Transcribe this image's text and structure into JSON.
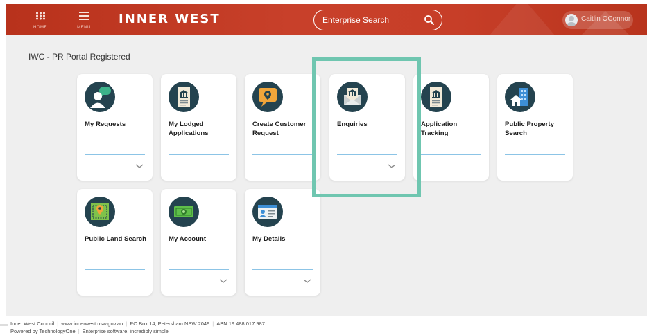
{
  "header": {
    "nav_home_label": "HOME",
    "nav_menu_label": "MENU",
    "brand": "INNER WEST",
    "search_placeholder": "Enterprise Search",
    "user_name": "Caitlin OConnor",
    "colors": {
      "header_red": "#c33b24",
      "accent_teal": "#6fc6b0",
      "icon_navy": "#24434f"
    }
  },
  "main": {
    "title": "IWC - PR Portal Registered",
    "tiles": [
      {
        "label": "My Requests",
        "icon": "person-chat-icon",
        "expandable": true
      },
      {
        "label": "My Lodged Applications",
        "icon": "building-document-icon",
        "expandable": false
      },
      {
        "label": "Create Customer Request",
        "icon": "map-pin-chat-icon",
        "expandable": false
      },
      {
        "label": "Enquiries",
        "icon": "building-envelope-icon",
        "expandable": true,
        "highlighted": true
      },
      {
        "label": "Application Tracking",
        "icon": "building-document-icon",
        "expandable": false
      },
      {
        "label": "Public Property Search",
        "icon": "house-buildings-icon",
        "expandable": false
      },
      {
        "label": "Public Land Search",
        "icon": "land-map-pin-icon",
        "expandable": false
      },
      {
        "label": "My Account",
        "icon": "banknote-icon",
        "expandable": true
      },
      {
        "label": "My Details",
        "icon": "id-card-icon",
        "expandable": true
      }
    ]
  },
  "footer": {
    "org": "Inner West Council",
    "website": "www.innerwest.nsw.gov.au",
    "address": "PO Box 14, Petersham NSW 2049",
    "abn": "ABN  19 488 017 987",
    "powered": "Powered by TechnologyOne",
    "tagline": "Enterprise software, incredibly simple"
  }
}
